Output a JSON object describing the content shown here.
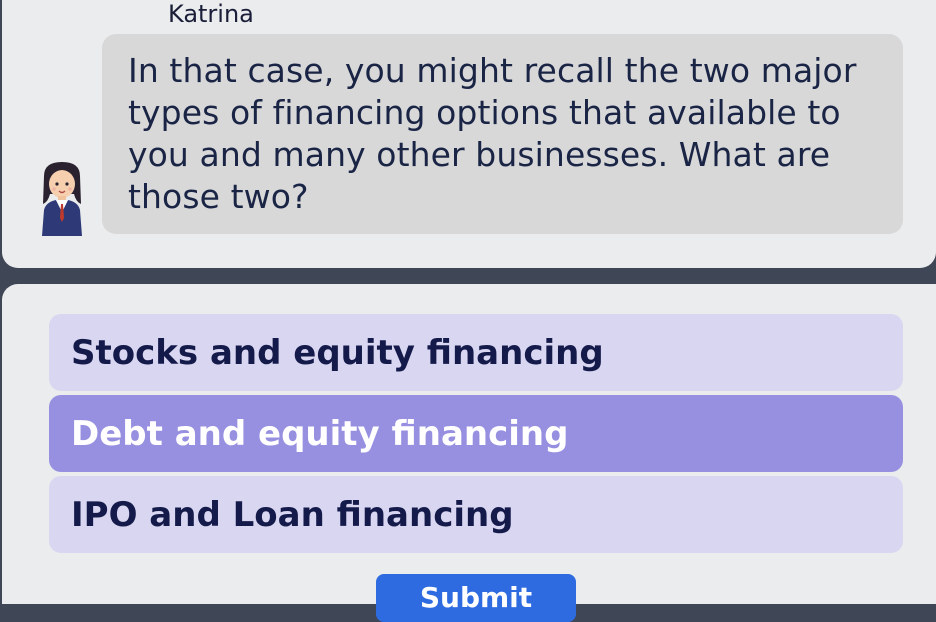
{
  "chat": {
    "speaker_name": "Katrina",
    "message": "In that case, you might recall the two major types of financing options that available to you and many other businesses.  What are those two?"
  },
  "options": [
    {
      "label": "Stocks and equity financing",
      "selected": false
    },
    {
      "label": "Debt and equity financing",
      "selected": true
    },
    {
      "label": "IPO and Loan financing",
      "selected": false
    }
  ],
  "submit_label": "Submit",
  "colors": {
    "option_bg": "#d9d6f1",
    "option_selected_bg": "#9790e1",
    "submit_bg": "#2f6be0",
    "bubble_bg": "#d8d8d9"
  }
}
